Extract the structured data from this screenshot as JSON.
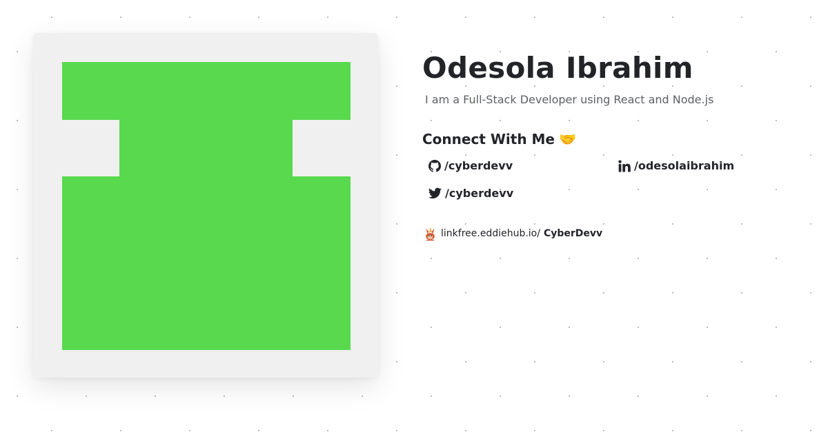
{
  "profile": {
    "name": "Odesola Ibrahim",
    "tagline": "I am a Full-Stack Developer using React and Node.js",
    "avatar_colors": {
      "background": "#f0f0f0",
      "foreground": "#58d94e"
    }
  },
  "connect": {
    "heading": "Connect With Me",
    "heading_emoji": "🤝",
    "links": [
      {
        "platform": "github",
        "icon": "github-icon",
        "handle": "/cyberdevv"
      },
      {
        "platform": "linkedin",
        "icon": "linkedin-icon",
        "handle": "/odesolaibrahim"
      },
      {
        "platform": "twitter",
        "icon": "twitter-icon",
        "handle": "/cyberdevv"
      }
    ]
  },
  "linkfree": {
    "icon": "linkfree-logo-icon",
    "prefix": "linkfree.eddiehub.io/",
    "handle": "CyberDevv"
  }
}
